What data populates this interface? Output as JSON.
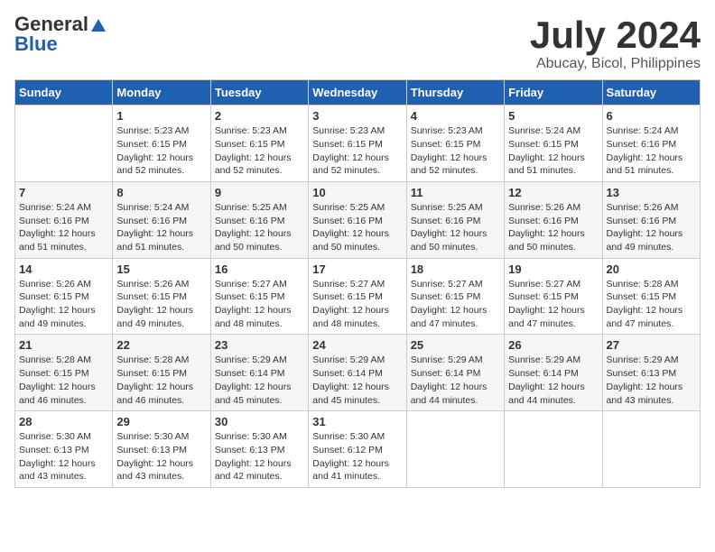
{
  "header": {
    "logo_general": "General",
    "logo_blue": "Blue",
    "month_title": "July 2024",
    "location": "Abucay, Bicol, Philippines"
  },
  "columns": [
    "Sunday",
    "Monday",
    "Tuesday",
    "Wednesday",
    "Thursday",
    "Friday",
    "Saturday"
  ],
  "weeks": [
    [
      {
        "day": "",
        "info": ""
      },
      {
        "day": "1",
        "info": "Sunrise: 5:23 AM\nSunset: 6:15 PM\nDaylight: 12 hours\nand 52 minutes."
      },
      {
        "day": "2",
        "info": "Sunrise: 5:23 AM\nSunset: 6:15 PM\nDaylight: 12 hours\nand 52 minutes."
      },
      {
        "day": "3",
        "info": "Sunrise: 5:23 AM\nSunset: 6:15 PM\nDaylight: 12 hours\nand 52 minutes."
      },
      {
        "day": "4",
        "info": "Sunrise: 5:23 AM\nSunset: 6:15 PM\nDaylight: 12 hours\nand 52 minutes."
      },
      {
        "day": "5",
        "info": "Sunrise: 5:24 AM\nSunset: 6:15 PM\nDaylight: 12 hours\nand 51 minutes."
      },
      {
        "day": "6",
        "info": "Sunrise: 5:24 AM\nSunset: 6:16 PM\nDaylight: 12 hours\nand 51 minutes."
      }
    ],
    [
      {
        "day": "7",
        "info": "Sunrise: 5:24 AM\nSunset: 6:16 PM\nDaylight: 12 hours\nand 51 minutes."
      },
      {
        "day": "8",
        "info": "Sunrise: 5:24 AM\nSunset: 6:16 PM\nDaylight: 12 hours\nand 51 minutes."
      },
      {
        "day": "9",
        "info": "Sunrise: 5:25 AM\nSunset: 6:16 PM\nDaylight: 12 hours\nand 50 minutes."
      },
      {
        "day": "10",
        "info": "Sunrise: 5:25 AM\nSunset: 6:16 PM\nDaylight: 12 hours\nand 50 minutes."
      },
      {
        "day": "11",
        "info": "Sunrise: 5:25 AM\nSunset: 6:16 PM\nDaylight: 12 hours\nand 50 minutes."
      },
      {
        "day": "12",
        "info": "Sunrise: 5:26 AM\nSunset: 6:16 PM\nDaylight: 12 hours\nand 50 minutes."
      },
      {
        "day": "13",
        "info": "Sunrise: 5:26 AM\nSunset: 6:16 PM\nDaylight: 12 hours\nand 49 minutes."
      }
    ],
    [
      {
        "day": "14",
        "info": "Sunrise: 5:26 AM\nSunset: 6:15 PM\nDaylight: 12 hours\nand 49 minutes."
      },
      {
        "day": "15",
        "info": "Sunrise: 5:26 AM\nSunset: 6:15 PM\nDaylight: 12 hours\nand 49 minutes."
      },
      {
        "day": "16",
        "info": "Sunrise: 5:27 AM\nSunset: 6:15 PM\nDaylight: 12 hours\nand 48 minutes."
      },
      {
        "day": "17",
        "info": "Sunrise: 5:27 AM\nSunset: 6:15 PM\nDaylight: 12 hours\nand 48 minutes."
      },
      {
        "day": "18",
        "info": "Sunrise: 5:27 AM\nSunset: 6:15 PM\nDaylight: 12 hours\nand 47 minutes."
      },
      {
        "day": "19",
        "info": "Sunrise: 5:27 AM\nSunset: 6:15 PM\nDaylight: 12 hours\nand 47 minutes."
      },
      {
        "day": "20",
        "info": "Sunrise: 5:28 AM\nSunset: 6:15 PM\nDaylight: 12 hours\nand 47 minutes."
      }
    ],
    [
      {
        "day": "21",
        "info": "Sunrise: 5:28 AM\nSunset: 6:15 PM\nDaylight: 12 hours\nand 46 minutes."
      },
      {
        "day": "22",
        "info": "Sunrise: 5:28 AM\nSunset: 6:15 PM\nDaylight: 12 hours\nand 46 minutes."
      },
      {
        "day": "23",
        "info": "Sunrise: 5:29 AM\nSunset: 6:14 PM\nDaylight: 12 hours\nand 45 minutes."
      },
      {
        "day": "24",
        "info": "Sunrise: 5:29 AM\nSunset: 6:14 PM\nDaylight: 12 hours\nand 45 minutes."
      },
      {
        "day": "25",
        "info": "Sunrise: 5:29 AM\nSunset: 6:14 PM\nDaylight: 12 hours\nand 44 minutes."
      },
      {
        "day": "26",
        "info": "Sunrise: 5:29 AM\nSunset: 6:14 PM\nDaylight: 12 hours\nand 44 minutes."
      },
      {
        "day": "27",
        "info": "Sunrise: 5:29 AM\nSunset: 6:13 PM\nDaylight: 12 hours\nand 43 minutes."
      }
    ],
    [
      {
        "day": "28",
        "info": "Sunrise: 5:30 AM\nSunset: 6:13 PM\nDaylight: 12 hours\nand 43 minutes."
      },
      {
        "day": "29",
        "info": "Sunrise: 5:30 AM\nSunset: 6:13 PM\nDaylight: 12 hours\nand 43 minutes."
      },
      {
        "day": "30",
        "info": "Sunrise: 5:30 AM\nSunset: 6:13 PM\nDaylight: 12 hours\nand 42 minutes."
      },
      {
        "day": "31",
        "info": "Sunrise: 5:30 AM\nSunset: 6:12 PM\nDaylight: 12 hours\nand 41 minutes."
      },
      {
        "day": "",
        "info": ""
      },
      {
        "day": "",
        "info": ""
      },
      {
        "day": "",
        "info": ""
      }
    ]
  ]
}
